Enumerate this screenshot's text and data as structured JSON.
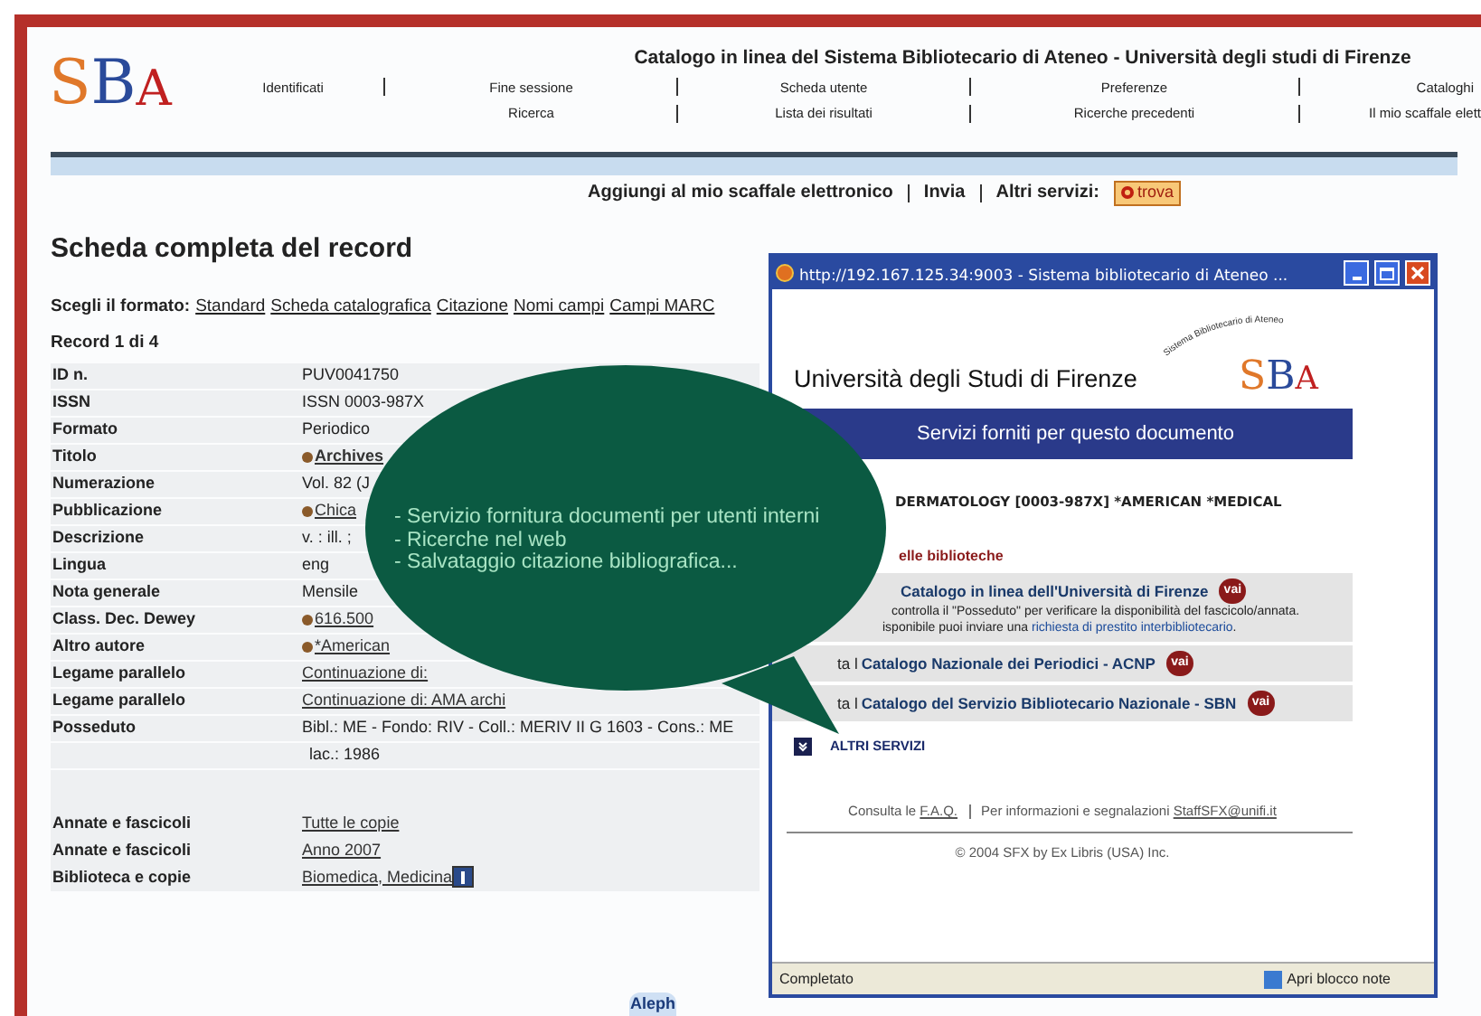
{
  "header": {
    "logo": "SBA",
    "title": "Catalogo in linea del Sistema Bibliotecario di Ateneo - Università degli studi di Firenze",
    "nav_top": [
      "Identificati",
      "Fine sessione",
      "Scheda utente",
      "Preferenze",
      "Cataloghi"
    ],
    "nav_bottom": [
      "Ricerca",
      "Lista dei risultati",
      "Ricerche precedenti",
      "Il mio scaffale elett"
    ]
  },
  "actions": {
    "items": [
      "Aggiungi al mio scaffale elettronico",
      "Invia"
    ],
    "other_label": "Altri servizi:",
    "button": "trova"
  },
  "page_title": "Scheda completa del record",
  "formats": {
    "label": "Scegli il formato:",
    "links": [
      "Standard",
      "Scheda catalografica",
      "Citazione",
      "Nomi campi",
      "Campi MARC"
    ]
  },
  "record_counter": "Record 1 di 4",
  "fields": [
    {
      "label": "ID n.",
      "value": "PUV0041750",
      "kind": "text"
    },
    {
      "label": "ISSN",
      "value": "ISSN 0003-987X",
      "kind": "text"
    },
    {
      "label": "Formato",
      "value": "Periodico",
      "kind": "text"
    },
    {
      "label": "Titolo",
      "value": "Archives",
      "kind": "bold_bullet_link"
    },
    {
      "label": "Numerazione",
      "value": "Vol. 82 (J",
      "kind": "text"
    },
    {
      "label": "Pubblicazione",
      "value": "Chica",
      "kind": "bullet_link"
    },
    {
      "label": "Descrizione",
      "value": "v. : ill. ;",
      "kind": "text"
    },
    {
      "label": "Lingua",
      "value": "eng",
      "kind": "text"
    },
    {
      "label": "Nota generale",
      "value": "Mensile",
      "kind": "text"
    },
    {
      "label": "Class. Dec. Dewey",
      "value": "616.500",
      "kind": "bullet_link"
    },
    {
      "label": "Altro autore",
      "value": "*American",
      "kind": "bullet_link"
    },
    {
      "label": "Legame parallelo",
      "value": "Continuazione di:",
      "kind": "link"
    },
    {
      "label": "Legame parallelo",
      "value": "Continuazione di: AMA archi",
      "kind": "link"
    },
    {
      "label": "Posseduto",
      "value": "Bibl.: ME - Fondo: RIV - Coll.: MERIV II G 1603 - Cons.: ME",
      "kind": "text",
      "continuation": "lac.: 1986"
    }
  ],
  "copies": [
    {
      "label": "Annate e fascicoli",
      "value": "Tutte le copie",
      "kind": "link"
    },
    {
      "label": "Annate e fascicoli",
      "value": "Anno 2007",
      "kind": "link"
    },
    {
      "label": "Biblioteca e copie",
      "value": "Biomedica, Medicina",
      "kind": "link_info"
    }
  ],
  "popup": {
    "title": "http://192.167.125.34:9003 - Sistema bibliotecario di Ateneo ...",
    "university": "Università degli Studi di Firenze",
    "logo": "SBA",
    "logo_arc": "Sistema Bibliotecario di Ateneo",
    "band": "Servizi forniti per questo documento",
    "citation": "DERMATOLOGY [0003-987X] *AMERICAN *MEDICAL",
    "section": "elle biblioteche",
    "services": [
      {
        "link": "Catalogo in linea dell'Università di Firenze",
        "button": "vai",
        "note": "controlla il \"Posseduto\" per verificare la disponibilità del fascicolo/annata.",
        "note2": "isponibile puoi inviare una",
        "note2_link": "richiesta di prestito interbibliotecario",
        "note2_end": "."
      },
      {
        "prefix": "ta l",
        "link": "Catalogo Nazionale dei Periodici - ACNP",
        "button": "vai"
      },
      {
        "prefix": "ta l",
        "link": "Catalogo del Servizio Bibliotecario Nazionale - SBN",
        "button": "vai"
      }
    ],
    "more": "ALTRI SERVIZI",
    "faq_prefix": "Consulta le",
    "faq": "F.A.Q.",
    "info": "Per informazioni e segnalazioni",
    "email": "StaffSFX@unifi.it",
    "copyright": "© 2004 SFX by Ex Libris (USA) Inc.",
    "status": "Completato",
    "notepad": "Apri blocco note"
  },
  "bubble": {
    "lines": [
      "- Servizio fornitura  documenti per utenti interni",
      "- Ricerche nel web",
      "- Salvataggio citazione bibliografica..."
    ]
  },
  "footer_logo": "Aleph"
}
